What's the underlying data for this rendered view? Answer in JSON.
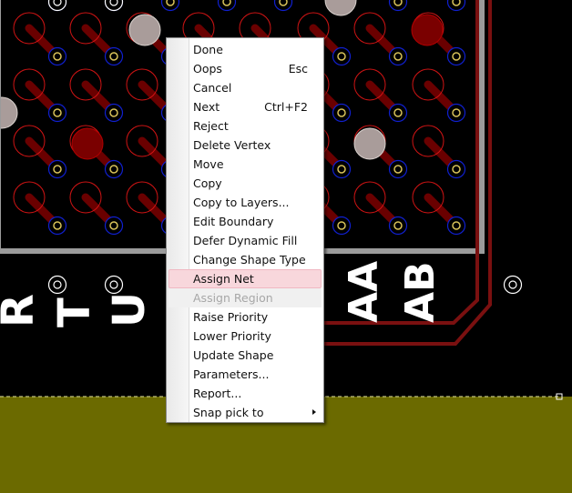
{
  "colors": {
    "board_bg": "#000000",
    "pad_ring": "#d21414",
    "trace": "#6a0000",
    "via_ring": "#1020d0",
    "via_center": "#d8c25a",
    "selected_pad": "#a99c9a",
    "silkscreen": "#ffffff",
    "boundary": "#9b9b9b",
    "outline": "#7a1010",
    "plane": "#6b6a00",
    "menu_highlight": "#f8d7dc"
  },
  "silkscreen_labels": [
    "R",
    "T",
    "U",
    "AA",
    "AB"
  ],
  "context_menu": {
    "items": [
      {
        "label": "Done",
        "accel": "",
        "state": "normal",
        "icon": ""
      },
      {
        "label": "Oops",
        "accel": "Esc",
        "state": "normal",
        "icon": ""
      },
      {
        "label": "Cancel",
        "accel": "",
        "state": "normal",
        "icon": ""
      },
      {
        "label": "Next",
        "accel": "Ctrl+F2",
        "state": "normal",
        "icon": ""
      },
      {
        "label": "Reject",
        "accel": "",
        "state": "normal",
        "icon": ""
      },
      {
        "label": "Delete Vertex",
        "accel": "",
        "state": "normal",
        "icon": ""
      },
      {
        "label": "Move",
        "accel": "",
        "state": "normal",
        "icon": ""
      },
      {
        "label": "Copy",
        "accel": "",
        "state": "normal",
        "icon": ""
      },
      {
        "label": "Copy to Layers...",
        "accel": "",
        "state": "normal",
        "icon": ""
      },
      {
        "label": "Edit Boundary",
        "accel": "",
        "state": "normal",
        "icon": ""
      },
      {
        "label": "Defer Dynamic Fill",
        "accel": "",
        "state": "normal",
        "icon": ""
      },
      {
        "label": "Change Shape Type",
        "accel": "",
        "state": "normal",
        "icon": ""
      },
      {
        "label": "Assign Net",
        "accel": "",
        "state": "highlighted",
        "icon": ""
      },
      {
        "label": "Assign Region",
        "accel": "",
        "state": "disabled",
        "icon": ""
      },
      {
        "label": "Raise Priority",
        "accel": "",
        "state": "normal",
        "icon": ""
      },
      {
        "label": "Lower Priority",
        "accel": "",
        "state": "normal",
        "icon": ""
      },
      {
        "label": "Update Shape",
        "accel": "",
        "state": "normal",
        "icon": ""
      },
      {
        "label": "Parameters...",
        "accel": "",
        "state": "normal",
        "icon": ""
      },
      {
        "label": "Report...",
        "accel": "",
        "state": "normal",
        "icon": ""
      },
      {
        "label": "Snap pick to",
        "accel": "",
        "state": "normal",
        "icon": "submenu-arrow-icon"
      }
    ]
  }
}
